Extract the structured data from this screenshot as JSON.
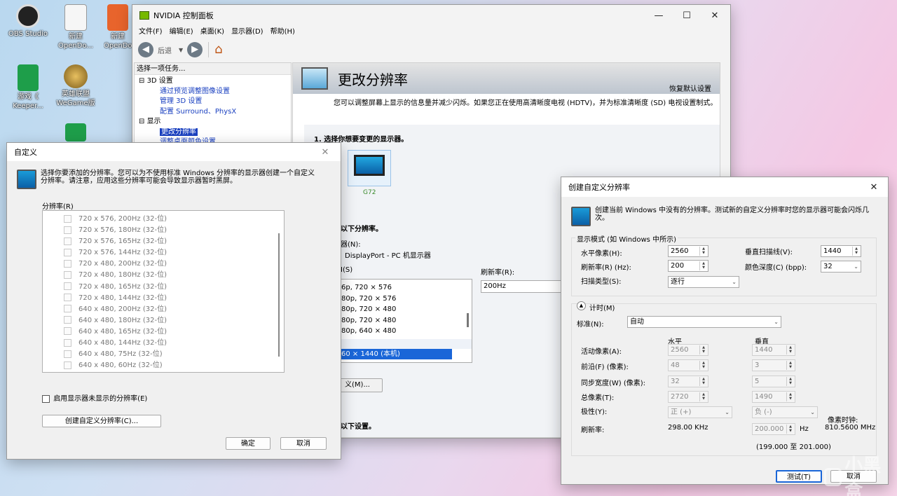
{
  "desktop": {
    "icons": [
      {
        "label": "OBS Studio",
        "color": "#222222"
      },
      {
        "label": "新建 OpenDo...",
        "color": "#f6f6f6"
      },
      {
        "label": "新建 OpenDo...",
        "color": "#e8642c"
      },
      {
        "label": "游戏《 Keeper...",
        "color": "#1e9e4a"
      },
      {
        "label": "英雄联盟 WeGame版",
        "color": "#c8a040"
      }
    ],
    "watermark": "小黑盒"
  },
  "nvidia": {
    "title": "NVIDIA 控制面板",
    "menu": [
      "文件(F)",
      "编辑(E)",
      "桌面(K)",
      "显示器(D)",
      "帮助(H)"
    ],
    "back_label": "后退",
    "task_header": "选择一项任务...",
    "tree": [
      {
        "label": "3D 设置",
        "level": 0
      },
      {
        "label": "通过预览调整图像设置",
        "level": 1
      },
      {
        "label": "管理 3D 设置",
        "level": 1
      },
      {
        "label": "配置 Surround、PhysX",
        "level": 1
      },
      {
        "label": "显示",
        "level": 0
      },
      {
        "label": "更改分辨率",
        "level": 1
      },
      {
        "label": "调整桌面颜色设置",
        "level": 1
      }
    ],
    "page_title": "更改分辨率",
    "restore_defaults": "恢复默认设置",
    "description": "您可以调整屏幕上显示的信息量并减少闪烁。如果您正在使用高清晰度电视 (HDTV)，并为标准清晰度 (SD) 电视设置制式。",
    "step1": "1. 选择你想要变更的显示器。",
    "monitor_name": "G72",
    "step2": "以下分辨率。",
    "connector_label": "器(N):",
    "connector_value": "DisplayPort - PC 机显示器",
    "res_label": "I(S)",
    "res_items": [
      "6p, 720 × 576",
      "80p, 720 × 576",
      "80p, 720 × 480",
      "80p, 720 × 480",
      "80p, 640 × 480"
    ],
    "res_selected": "60 × 1440 (本机)",
    "refresh_label": "刷新率(R):",
    "refresh_value": "200Hz",
    "custom_button": "义(M)...",
    "step3": "以下设置。"
  },
  "custom_dialog": {
    "title": "自定义",
    "info": "选择你要添加的分辨率。您可以为不使用标准 Windows 分辨率的显示器创建一个自定义分辨率。请注意，应用这些分辨率可能会导致显示器暂时黑屏。",
    "list_label": "分辨率(R)",
    "resolutions": [
      "720 x 576, 200Hz (32-位)",
      "720 x 576, 180Hz (32-位)",
      "720 x 576, 165Hz (32-位)",
      "720 x 576, 144Hz (32-位)",
      "720 x 480, 200Hz (32-位)",
      "720 x 480, 180Hz (32-位)",
      "720 x 480, 165Hz (32-位)",
      "720 x 480, 144Hz (32-位)",
      "640 x 480, 200Hz (32-位)",
      "640 x 480, 180Hz (32-位)",
      "640 x 480, 165Hz (32-位)",
      "640 x 480, 144Hz (32-位)",
      "640 x 480, 75Hz (32-位)",
      "640 x 480, 60Hz (32-位)"
    ],
    "enable_label": "启用显示器未显示的分辨率(E)",
    "create_button": "创建自定义分辨率(C)...",
    "ok": "确定",
    "cancel": "取消"
  },
  "create_dialog": {
    "title": "创建自定义分辨率",
    "info": "创建当前 Windows 中没有的分辨率。测试新的自定义分辨率时您的显示器可能会闪烁几次。",
    "display_mode_title": "显示模式 (如 Windows 中所示)",
    "h_pixels_label": "水平像素(H):",
    "h_pixels": "2560",
    "v_lines_label": "垂直扫描线(V):",
    "v_lines": "1440",
    "refresh_label": "刷新率(R) (Hz):",
    "refresh": "200",
    "color_depth_label": "颜色深度(C) (bpp):",
    "color_depth": "32",
    "scan_label": "扫描类型(S):",
    "scan": "逐行",
    "timing_title": "计时(M)",
    "standard_label": "标准(N):",
    "standard": "自动",
    "col_h": "水平",
    "col_v": "垂直",
    "rows": [
      {
        "label": "活动像素(A):",
        "h": "2560",
        "v": "1440"
      },
      {
        "label": "前沿(F) (像素):",
        "h": "48",
        "v": "3"
      },
      {
        "label": "同步宽度(W) (像素):",
        "h": "32",
        "v": "5"
      },
      {
        "label": "总像素(T):",
        "h": "2720",
        "v": "1490"
      }
    ],
    "polarity_label": "极性(Y):",
    "polarity_h": "正 (+)",
    "polarity_v": "负 (-)",
    "pixel_clock_label": "像素时钟:",
    "pixel_clock": "810.5600 MHz",
    "rate_label": "刷新率:",
    "rate_h": "298.00 KHz",
    "rate_v": "200.000",
    "rate_unit": "Hz",
    "range": "(199.000 至 201.000)",
    "test": "测试(T)",
    "cancel": "取消"
  }
}
